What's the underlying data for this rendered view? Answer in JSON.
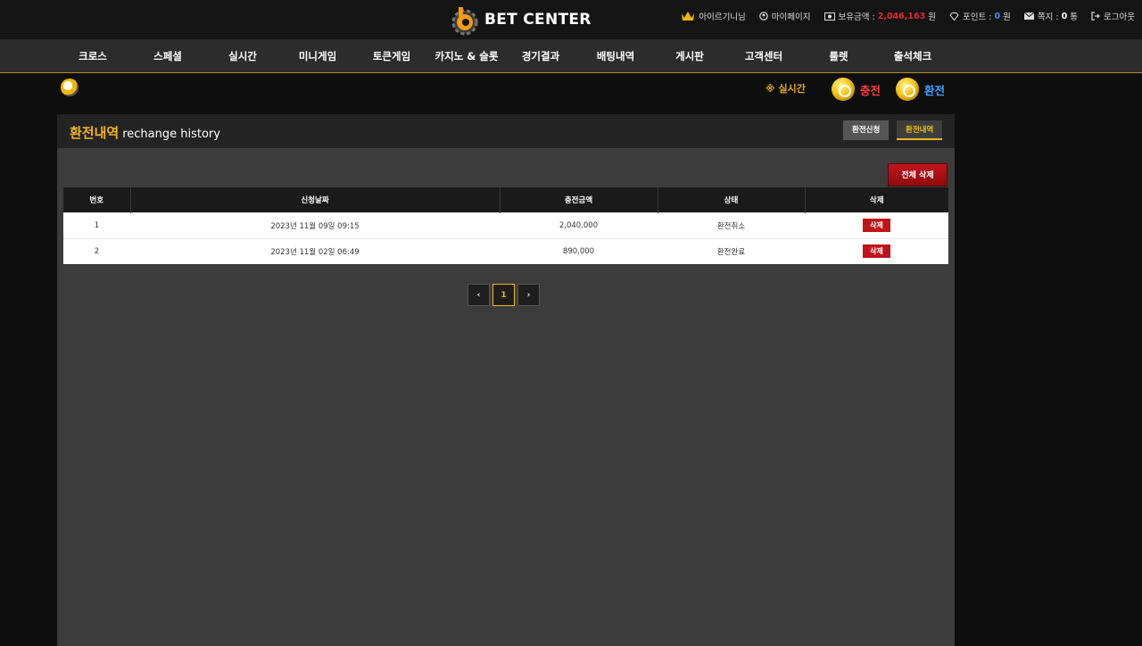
{
  "header": {
    "logo_text": "BET CENTER",
    "user_name": "아이르기니님",
    "mypage": "마이페이지",
    "balance_label": "보유금액 :",
    "balance_value": "2,046,163",
    "balance_unit": "원",
    "point_label": "포인트 :",
    "point_value": "0",
    "point_unit": "원",
    "note_label": "쪽지 :",
    "note_value": "0",
    "note_unit": "통",
    "logout": "로그아웃"
  },
  "nav": {
    "items": [
      "크로스",
      "스페셜",
      "실시간",
      "미니게임",
      "토큰게임",
      "카지노 & 슬롯",
      "경기결과",
      "배팅내역",
      "게시판",
      "고객센터",
      "룰렛",
      "출석체크"
    ]
  },
  "subbar": {
    "realtime": "※ 실시간",
    "charge": "충전",
    "exchange": "환전"
  },
  "panel": {
    "title": "환전내역",
    "title_en": "rechange history",
    "tab_apply": "환전신청",
    "tab_history": "환전내역",
    "delete_all": "전체 삭제"
  },
  "table": {
    "headers": [
      "번호",
      "신청날짜",
      "충전금액",
      "상태",
      "삭제"
    ],
    "rows": [
      {
        "no": "1",
        "date": "2023년 11월 09일 09:15",
        "amount": "2,040,000",
        "status": "환전취소",
        "delete": "삭제"
      },
      {
        "no": "2",
        "date": "2023년 11월 02일 06:49",
        "amount": "890,000",
        "status": "환전완료",
        "delete": "삭제"
      }
    ]
  },
  "pagination": {
    "prev": "‹",
    "current": "1",
    "next": "›"
  },
  "colors": {
    "accent_gold": "#f0b41c",
    "money_red": "#e5262e",
    "point_blue": "#3b8ff0",
    "delete_red": "#c0141a"
  }
}
